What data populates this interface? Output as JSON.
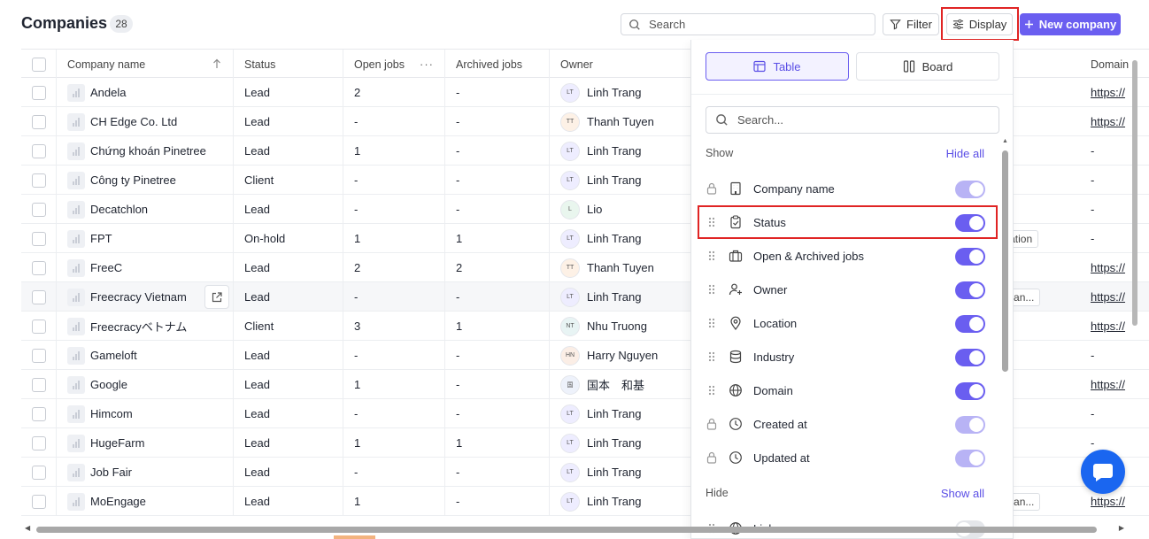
{
  "header": {
    "title": "Companies",
    "count": "28",
    "search_placeholder": "Search",
    "filter_label": "Filter",
    "display_label": "Display",
    "new_company_label": "New company"
  },
  "table": {
    "columns": {
      "company_name": "Company name",
      "status": "Status",
      "open_jobs": "Open jobs",
      "archived_jobs": "Archived jobs",
      "owner": "Owner",
      "domain": "Domain"
    },
    "rows": [
      {
        "name": "Andela",
        "status": "Lead",
        "open": "2",
        "archived": "-",
        "owner_initials": "LT",
        "owner": "Linh Trang",
        "industry": "",
        "domain": "https://"
      },
      {
        "name": "CH Edge Co. Ltd",
        "status": "Lead",
        "open": "-",
        "archived": "-",
        "owner_initials": "TT",
        "owner": "Thanh Tuyen",
        "industry": "",
        "domain": "https://"
      },
      {
        "name": "Chứng khoán Pinetree",
        "status": "Lead",
        "open": "1",
        "archived": "-",
        "owner_initials": "LT",
        "owner": "Linh Trang",
        "industry": "",
        "domain": "-"
      },
      {
        "name": "Công ty Pinetree",
        "status": "Client",
        "open": "-",
        "archived": "-",
        "owner_initials": "LT",
        "owner": "Linh Trang",
        "industry": "",
        "domain": "-"
      },
      {
        "name": "Decatchlon",
        "status": "Lead",
        "open": "-",
        "archived": "-",
        "owner_initials": "L",
        "owner": "Lio",
        "industry": "",
        "domain": "-"
      },
      {
        "name": "FPT",
        "status": "On-hold",
        "open": "1",
        "archived": "1",
        "owner_initials": "LT",
        "owner": "Linh Trang",
        "industry": "Airlines/Aviation",
        "domain": "-"
      },
      {
        "name": "FreeC",
        "status": "Lead",
        "open": "2",
        "archived": "2",
        "owner_initials": "TT",
        "owner": "Thanh Tuyen",
        "industry": "",
        "domain": "https://"
      },
      {
        "name": "Freecracy Vietnam",
        "status": "Lead",
        "open": "-",
        "archived": "-",
        "owner_initials": "LT",
        "owner": "Linh Trang",
        "industry": "Technology an...",
        "domain": "https://"
      },
      {
        "name": "Freecracyベトナム",
        "status": "Client",
        "open": "3",
        "archived": "1",
        "owner_initials": "NT",
        "owner": "Nhu Truong",
        "industry": "",
        "domain": "https://"
      },
      {
        "name": "Gameloft",
        "status": "Lead",
        "open": "-",
        "archived": "-",
        "owner_initials": "HN",
        "owner": "Harry Nguyen",
        "industry": "",
        "domain": "-"
      },
      {
        "name": "Google",
        "status": "Lead",
        "open": "1",
        "archived": "-",
        "owner_initials": "国",
        "owner": "国本　和基",
        "industry": "",
        "domain": "https://"
      },
      {
        "name": "Himcom",
        "status": "Lead",
        "open": "-",
        "archived": "-",
        "owner_initials": "LT",
        "owner": "Linh Trang",
        "industry": "",
        "domain": "-"
      },
      {
        "name": "HugeFarm",
        "status": "Lead",
        "open": "1",
        "archived": "1",
        "owner_initials": "LT",
        "owner": "Linh Trang",
        "industry": "",
        "domain": "-"
      },
      {
        "name": "Job Fair",
        "status": "Lead",
        "open": "-",
        "archived": "-",
        "owner_initials": "LT",
        "owner": "Linh Trang",
        "industry": "",
        "domain": "-"
      },
      {
        "name": "MoEngage",
        "status": "Lead",
        "open": "1",
        "archived": "-",
        "owner_initials": "LT",
        "owner": "Linh Trang",
        "industry": "Technology an...",
        "domain": "https://"
      }
    ]
  },
  "display_panel": {
    "view_table": "Table",
    "view_board": "Board",
    "search_placeholder": "Search...",
    "show_title": "Show",
    "hide_all": "Hide all",
    "hide_title": "Hide",
    "show_all": "Show all",
    "shown_fields": [
      {
        "label": "Company name",
        "icon": "building-icon",
        "locked": true,
        "state": "on-disabled"
      },
      {
        "label": "Status",
        "icon": "clipboard-check-icon",
        "locked": false,
        "state": "on"
      },
      {
        "label": "Open & Archived jobs",
        "icon": "briefcase-icon",
        "locked": false,
        "state": "on"
      },
      {
        "label": "Owner",
        "icon": "user-plus-icon",
        "locked": false,
        "state": "on"
      },
      {
        "label": "Location",
        "icon": "map-pin-icon",
        "locked": false,
        "state": "on"
      },
      {
        "label": "Industry",
        "icon": "database-icon",
        "locked": false,
        "state": "on"
      },
      {
        "label": "Domain",
        "icon": "globe-icon",
        "locked": false,
        "state": "on"
      },
      {
        "label": "Created at",
        "icon": "clock-icon",
        "locked": true,
        "state": "on-disabled"
      },
      {
        "label": "Updated at",
        "icon": "clock-icon",
        "locked": true,
        "state": "on-disabled"
      }
    ],
    "hidden_fields": [
      {
        "label": "Links",
        "icon": "globe-icon",
        "locked": false,
        "state": "off"
      }
    ]
  },
  "colors": {
    "accent": "#6a5ef0",
    "highlight": "#e02424",
    "chat": "#1a66f0"
  }
}
